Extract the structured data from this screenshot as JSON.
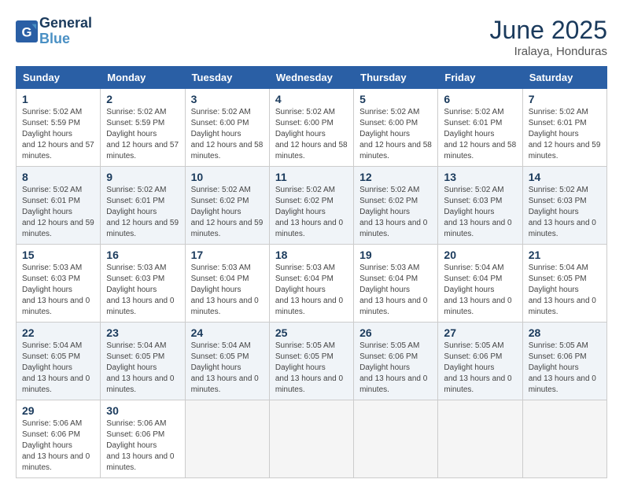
{
  "logo": {
    "line1": "General",
    "line2": "Blue"
  },
  "title": "June 2025",
  "subtitle": "Iralaya, Honduras",
  "weekdays": [
    "Sunday",
    "Monday",
    "Tuesday",
    "Wednesday",
    "Thursday",
    "Friday",
    "Saturday"
  ],
  "weeks": [
    [
      {
        "day": "1",
        "sunrise": "5:02 AM",
        "sunset": "5:59 PM",
        "daylight": "12 hours and 57 minutes."
      },
      {
        "day": "2",
        "sunrise": "5:02 AM",
        "sunset": "5:59 PM",
        "daylight": "12 hours and 57 minutes."
      },
      {
        "day": "3",
        "sunrise": "5:02 AM",
        "sunset": "6:00 PM",
        "daylight": "12 hours and 58 minutes."
      },
      {
        "day": "4",
        "sunrise": "5:02 AM",
        "sunset": "6:00 PM",
        "daylight": "12 hours and 58 minutes."
      },
      {
        "day": "5",
        "sunrise": "5:02 AM",
        "sunset": "6:00 PM",
        "daylight": "12 hours and 58 minutes."
      },
      {
        "day": "6",
        "sunrise": "5:02 AM",
        "sunset": "6:01 PM",
        "daylight": "12 hours and 58 minutes."
      },
      {
        "day": "7",
        "sunrise": "5:02 AM",
        "sunset": "6:01 PM",
        "daylight": "12 hours and 59 minutes."
      }
    ],
    [
      {
        "day": "8",
        "sunrise": "5:02 AM",
        "sunset": "6:01 PM",
        "daylight": "12 hours and 59 minutes."
      },
      {
        "day": "9",
        "sunrise": "5:02 AM",
        "sunset": "6:01 PM",
        "daylight": "12 hours and 59 minutes."
      },
      {
        "day": "10",
        "sunrise": "5:02 AM",
        "sunset": "6:02 PM",
        "daylight": "12 hours and 59 minutes."
      },
      {
        "day": "11",
        "sunrise": "5:02 AM",
        "sunset": "6:02 PM",
        "daylight": "13 hours and 0 minutes."
      },
      {
        "day": "12",
        "sunrise": "5:02 AM",
        "sunset": "6:02 PM",
        "daylight": "13 hours and 0 minutes."
      },
      {
        "day": "13",
        "sunrise": "5:02 AM",
        "sunset": "6:03 PM",
        "daylight": "13 hours and 0 minutes."
      },
      {
        "day": "14",
        "sunrise": "5:02 AM",
        "sunset": "6:03 PM",
        "daylight": "13 hours and 0 minutes."
      }
    ],
    [
      {
        "day": "15",
        "sunrise": "5:03 AM",
        "sunset": "6:03 PM",
        "daylight": "13 hours and 0 minutes."
      },
      {
        "day": "16",
        "sunrise": "5:03 AM",
        "sunset": "6:03 PM",
        "daylight": "13 hours and 0 minutes."
      },
      {
        "day": "17",
        "sunrise": "5:03 AM",
        "sunset": "6:04 PM",
        "daylight": "13 hours and 0 minutes."
      },
      {
        "day": "18",
        "sunrise": "5:03 AM",
        "sunset": "6:04 PM",
        "daylight": "13 hours and 0 minutes."
      },
      {
        "day": "19",
        "sunrise": "5:03 AM",
        "sunset": "6:04 PM",
        "daylight": "13 hours and 0 minutes."
      },
      {
        "day": "20",
        "sunrise": "5:04 AM",
        "sunset": "6:04 PM",
        "daylight": "13 hours and 0 minutes."
      },
      {
        "day": "21",
        "sunrise": "5:04 AM",
        "sunset": "6:05 PM",
        "daylight": "13 hours and 0 minutes."
      }
    ],
    [
      {
        "day": "22",
        "sunrise": "5:04 AM",
        "sunset": "6:05 PM",
        "daylight": "13 hours and 0 minutes."
      },
      {
        "day": "23",
        "sunrise": "5:04 AM",
        "sunset": "6:05 PM",
        "daylight": "13 hours and 0 minutes."
      },
      {
        "day": "24",
        "sunrise": "5:04 AM",
        "sunset": "6:05 PM",
        "daylight": "13 hours and 0 minutes."
      },
      {
        "day": "25",
        "sunrise": "5:05 AM",
        "sunset": "6:05 PM",
        "daylight": "13 hours and 0 minutes."
      },
      {
        "day": "26",
        "sunrise": "5:05 AM",
        "sunset": "6:06 PM",
        "daylight": "13 hours and 0 minutes."
      },
      {
        "day": "27",
        "sunrise": "5:05 AM",
        "sunset": "6:06 PM",
        "daylight": "13 hours and 0 minutes."
      },
      {
        "day": "28",
        "sunrise": "5:05 AM",
        "sunset": "6:06 PM",
        "daylight": "13 hours and 0 minutes."
      }
    ],
    [
      {
        "day": "29",
        "sunrise": "5:06 AM",
        "sunset": "6:06 PM",
        "daylight": "13 hours and 0 minutes."
      },
      {
        "day": "30",
        "sunrise": "5:06 AM",
        "sunset": "6:06 PM",
        "daylight": "13 hours and 0 minutes."
      },
      null,
      null,
      null,
      null,
      null
    ]
  ]
}
